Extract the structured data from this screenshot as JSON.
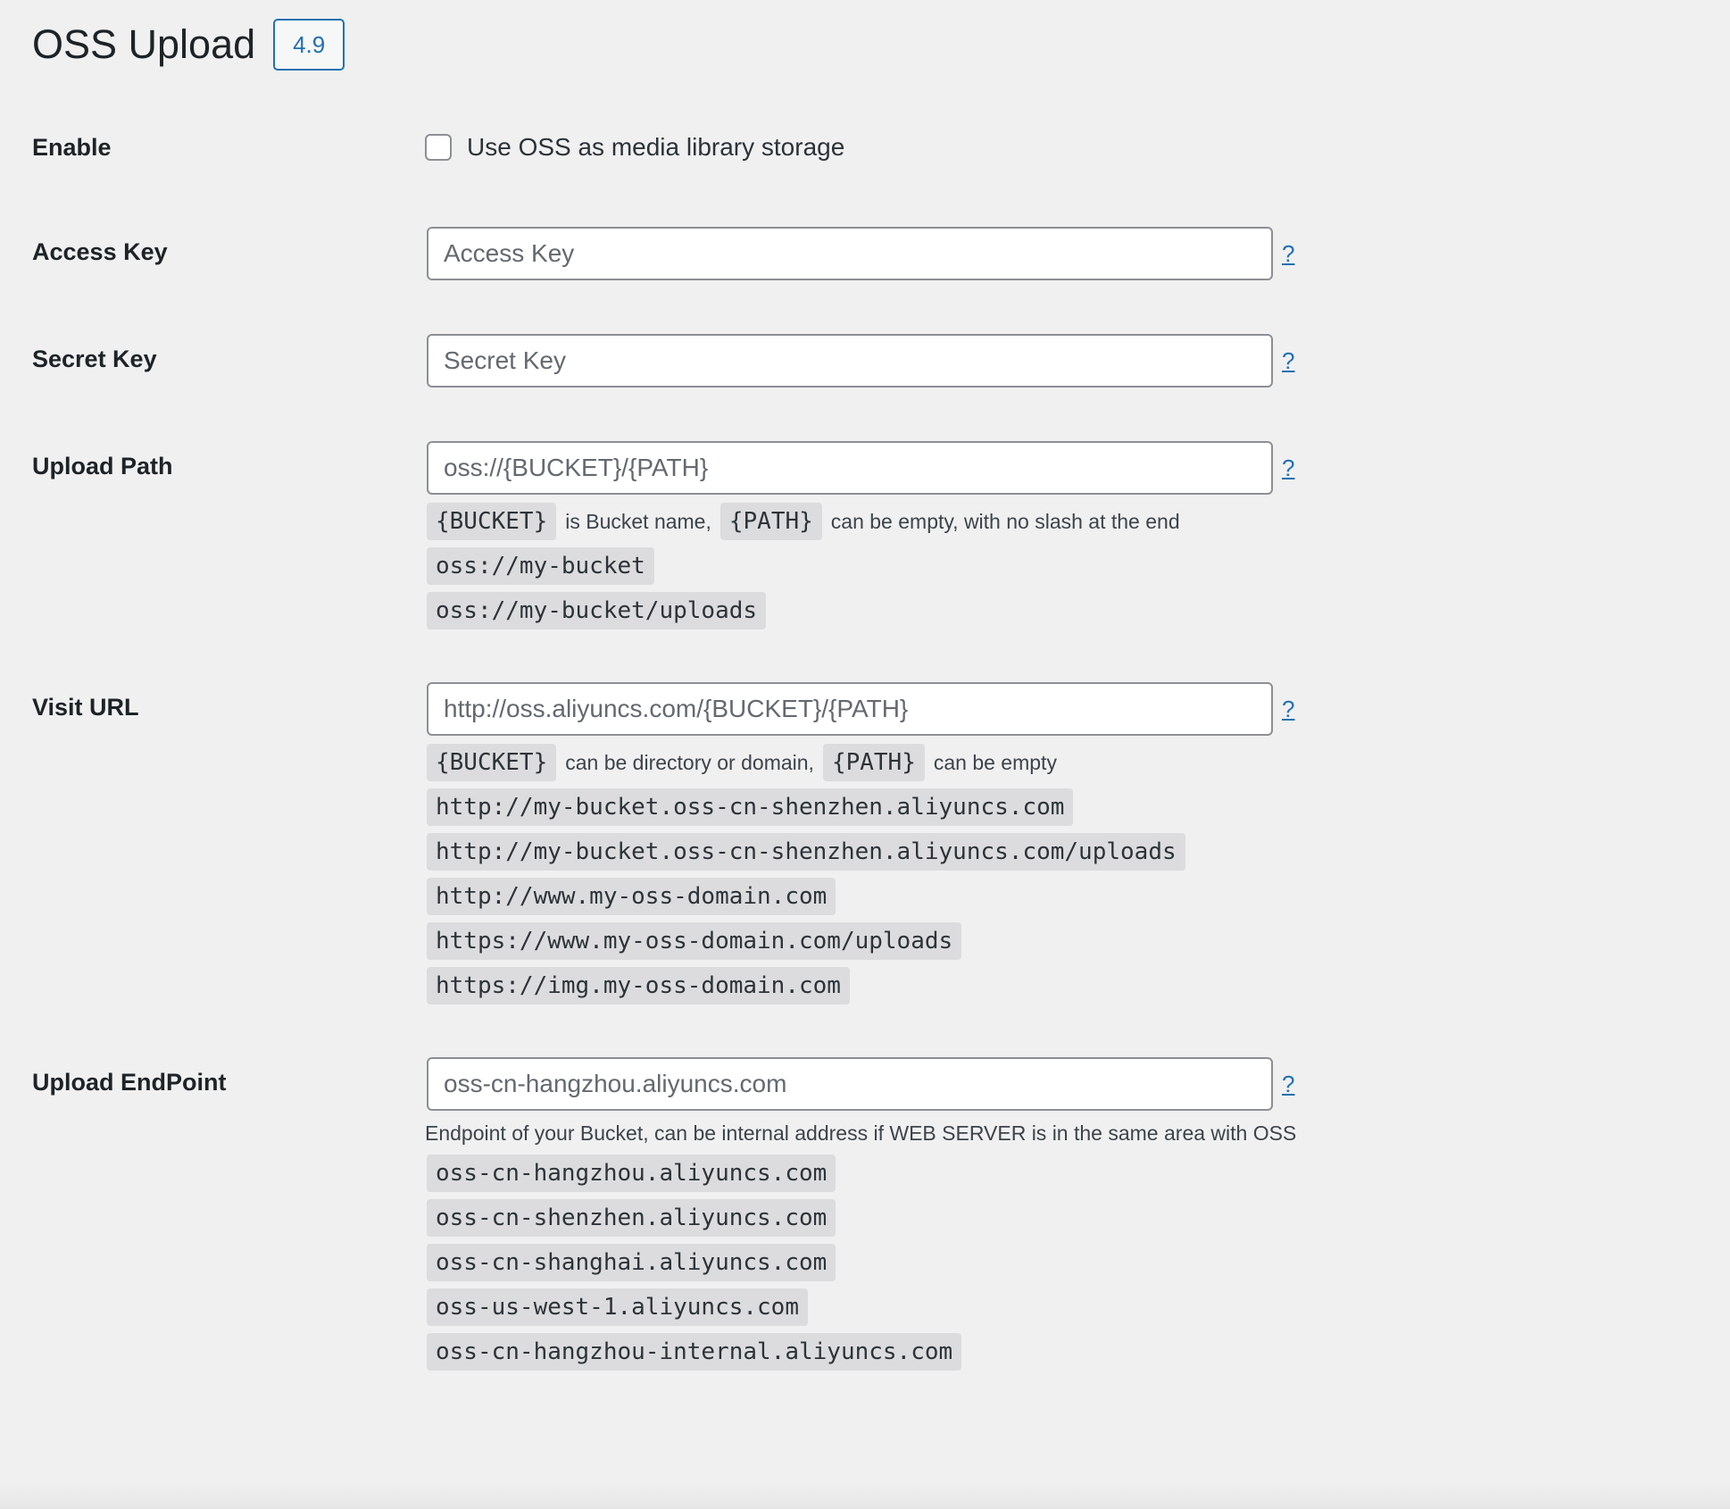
{
  "header": {
    "title": "OSS Upload",
    "version": "4.9"
  },
  "enable": {
    "label": "Enable",
    "checkbox_label": "Use OSS as media library storage",
    "checked": false
  },
  "access_key": {
    "label": "Access Key",
    "placeholder": "Access Key",
    "help": "?"
  },
  "secret_key": {
    "label": "Secret Key",
    "placeholder": "Secret Key",
    "help": "?"
  },
  "upload_path": {
    "label": "Upload Path",
    "placeholder": "oss://{BUCKET}/{PATH}",
    "help": "?",
    "hint": {
      "token1": "{BUCKET}",
      "text1": "is Bucket name,",
      "token2": "{PATH}",
      "text2": "can be empty, with no slash at the end"
    },
    "examples": [
      "oss://my-bucket",
      "oss://my-bucket/uploads"
    ]
  },
  "visit_url": {
    "label": "Visit URL",
    "placeholder": "http://oss.aliyuncs.com/{BUCKET}/{PATH}",
    "help": "?",
    "hint": {
      "token1": "{BUCKET}",
      "text1": "can be directory or domain,",
      "token2": "{PATH}",
      "text2": "can be empty"
    },
    "examples": [
      "http://my-bucket.oss-cn-shenzhen.aliyuncs.com",
      "http://my-bucket.oss-cn-shenzhen.aliyuncs.com/uploads",
      "http://www.my-oss-domain.com",
      "https://www.my-oss-domain.com/uploads",
      "https://img.my-oss-domain.com"
    ]
  },
  "upload_endpoint": {
    "label": "Upload EndPoint",
    "placeholder": "oss-cn-hangzhou.aliyuncs.com",
    "help": "?",
    "hint": "Endpoint of your Bucket, can be internal address if WEB SERVER is in the same area with OSS",
    "examples": [
      "oss-cn-hangzhou.aliyuncs.com",
      "oss-cn-shenzhen.aliyuncs.com",
      "oss-cn-shanghai.aliyuncs.com",
      "oss-us-west-1.aliyuncs.com",
      "oss-cn-hangzhou-internal.aliyuncs.com"
    ]
  }
}
